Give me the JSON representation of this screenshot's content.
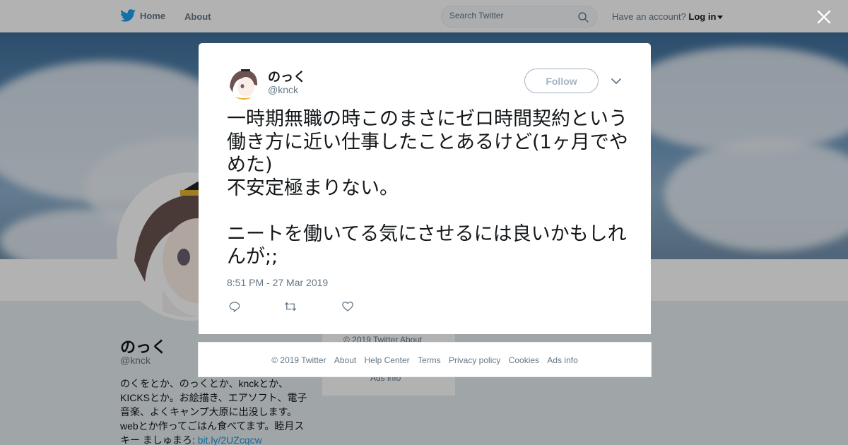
{
  "nav": {
    "home_label": "Home",
    "about_label": "About",
    "search_placeholder": "Search Twitter",
    "account_prompt": "Have an account?",
    "login_label": "Log in"
  },
  "profile": {
    "name": "のっく",
    "handle": "@knck",
    "bio_text": "のくをとか、のっくとか、knckとか、KICKSとか。お絵描き、エアソフト、電子音楽、よくキャンプ大原に出没します。webとか作ってごはん食べてます。睦月スキー ましゅまろ: ",
    "bio_link": "bit.ly/2UZcqcw",
    "side_footer_line1": "© 2019 Twitter   About",
    "side_footer_line2": "Ads info"
  },
  "tweet": {
    "author_name": "のっく",
    "author_handle": "@knck",
    "follow_label": "Follow",
    "text": "一時期無職の時このまさにゼロ時間契約という働き方に近い仕事したことあるけど(1ヶ月でやめた)\n不安定極まりない。\n\nニートを働いてる気にさせるには良いかもしれんが;;",
    "timestamp": "8:51 PM - 27 Mar 2019"
  },
  "footer": {
    "copyright": "© 2019 Twitter",
    "about": "About",
    "help": "Help Center",
    "terms": "Terms",
    "privacy": "Privacy policy",
    "cookies": "Cookies",
    "ads": "Ads info"
  },
  "colors": {
    "accent": "#1da1f2",
    "text_primary": "#14171a",
    "text_secondary": "#657786"
  },
  "icons": {
    "logo": "twitter-bird-icon",
    "search": "search-icon",
    "close": "close-icon",
    "more": "chevron-down-icon",
    "reply": "reply-icon",
    "retweet": "retweet-icon",
    "like": "heart-icon"
  }
}
